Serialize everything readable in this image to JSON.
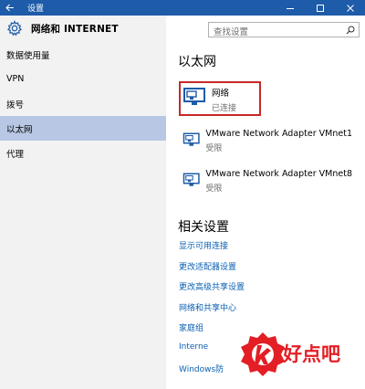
{
  "window": {
    "title": "设置",
    "controls": [
      "minimize-icon",
      "maximize-icon",
      "close-icon"
    ],
    "titlebar_color": "#1e5ba8"
  },
  "sidebar": {
    "header": "网络和 INTERNET",
    "items": [
      {
        "label": "数据使用量",
        "selected": false
      },
      {
        "label": "VPN",
        "selected": false
      },
      {
        "label": "拨号",
        "selected": false
      },
      {
        "label": "以太网",
        "selected": true
      },
      {
        "label": "代理",
        "selected": false
      }
    ]
  },
  "search": {
    "placeholder": "查找设置"
  },
  "main": {
    "section_title": "以太网",
    "networks": [
      {
        "name": "网络",
        "status": "已连接"
      },
      {
        "name": "VMware Network Adapter VMnet1",
        "status": "受限"
      },
      {
        "name": "VMware Network Adapter VMnet8",
        "status": "受限"
      }
    ],
    "related_title": "相关设置",
    "related_links": [
      "显示可用连接",
      "更改适配器设置",
      "更改高级共享设置",
      "网络和共享中心",
      "家庭组",
      "Interne",
      "Windows防"
    ]
  },
  "watermark": {
    "text": "好点吧",
    "color": "#e31e24"
  }
}
